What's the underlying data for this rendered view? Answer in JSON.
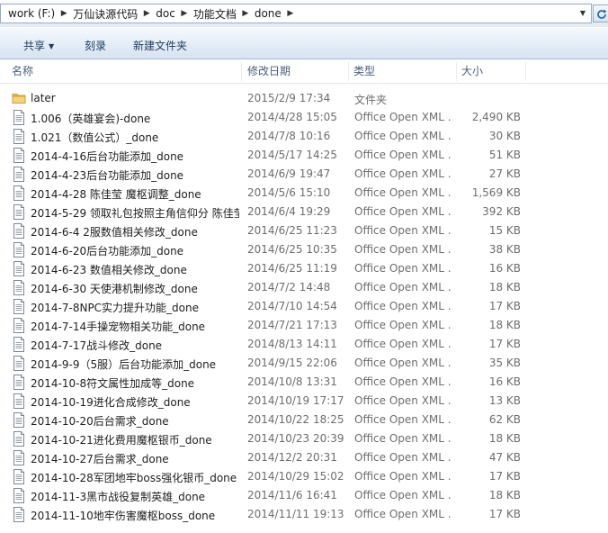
{
  "address": {
    "crumbs": [
      "work (F:)",
      "万仙诀源代码",
      "doc",
      "功能文档",
      "done"
    ]
  },
  "toolbar": {
    "share_label": "共享",
    "burn_label": "刻录",
    "new_folder_label": "新建文件夹"
  },
  "columns": {
    "name": "名称",
    "date": "修改日期",
    "type": "类型",
    "size": "大小"
  },
  "files": [
    {
      "kind": "folder",
      "name": "later",
      "date": "2015/2/9 17:34",
      "type": "文件夹",
      "size": ""
    },
    {
      "kind": "doc",
      "name": "1.006（英雄宴会)-done",
      "date": "2014/4/28 15:05",
      "type": "Office Open XML ...",
      "size": "2,490 KB"
    },
    {
      "kind": "doc",
      "name": "1.021（数值公式）_done",
      "date": "2014/7/8 10:16",
      "type": "Office Open XML ...",
      "size": "30 KB"
    },
    {
      "kind": "doc",
      "name": "2014-4-16后台功能添加_done",
      "date": "2014/5/17 14:25",
      "type": "Office Open XML ...",
      "size": "51 KB"
    },
    {
      "kind": "doc",
      "name": "2014-4-23后台功能添加_done",
      "date": "2014/6/9 19:47",
      "type": "Office Open XML ...",
      "size": "27 KB"
    },
    {
      "kind": "doc",
      "name": "2014-4-28 陈佳莹 魔枢调整_done",
      "date": "2014/5/6 15:10",
      "type": "Office Open XML ...",
      "size": "1,569 KB"
    },
    {
      "kind": "doc",
      "name": "2014-5-29 领取礼包按照主角信仰分 陈佳莹_done",
      "date": "2014/6/4 19:29",
      "type": "Office Open XML ...",
      "size": "392 KB"
    },
    {
      "kind": "doc",
      "name": "2014-6-4 2服数值相关修改_done",
      "date": "2014/6/25 11:23",
      "type": "Office Open XML ...",
      "size": "15 KB"
    },
    {
      "kind": "doc",
      "name": "2014-6-20后台功能添加_done",
      "date": "2014/6/25 10:35",
      "type": "Office Open XML ...",
      "size": "38 KB"
    },
    {
      "kind": "doc",
      "name": "2014-6-23 数值相关修改_done",
      "date": "2014/6/25 11:19",
      "type": "Office Open XML ...",
      "size": "16 KB"
    },
    {
      "kind": "doc",
      "name": "2014-6-30 天使港机制修改_done",
      "date": "2014/7/2 14:48",
      "type": "Office Open XML ...",
      "size": "18 KB"
    },
    {
      "kind": "doc",
      "name": "2014-7-8NPC实力提升功能_done",
      "date": "2014/7/10 14:54",
      "type": "Office Open XML ...",
      "size": "17 KB"
    },
    {
      "kind": "doc",
      "name": "2014-7-14手操宠物相关功能_done",
      "date": "2014/7/21 17:13",
      "type": "Office Open XML ...",
      "size": "18 KB"
    },
    {
      "kind": "doc",
      "name": "2014-7-17战斗修改_done",
      "date": "2014/8/13 14:11",
      "type": "Office Open XML ...",
      "size": "17 KB"
    },
    {
      "kind": "doc",
      "name": "2014-9-9（5服）后台功能添加_done",
      "date": "2014/9/15 22:06",
      "type": "Office Open XML ...",
      "size": "35 KB"
    },
    {
      "kind": "doc",
      "name": "2014-10-8符文属性加成等_done",
      "date": "2014/10/8 13:31",
      "type": "Office Open XML ...",
      "size": "16 KB"
    },
    {
      "kind": "doc",
      "name": "2014-10-19进化合成修改_done",
      "date": "2014/10/19 17:17",
      "type": "Office Open XML ...",
      "size": "13 KB"
    },
    {
      "kind": "doc",
      "name": "2014-10-20后台需求_done",
      "date": "2014/10/22 18:25",
      "type": "Office Open XML ...",
      "size": "62 KB"
    },
    {
      "kind": "doc",
      "name": "2014-10-21进化费用魔枢银币_done",
      "date": "2014/10/23 20:39",
      "type": "Office Open XML ...",
      "size": "18 KB"
    },
    {
      "kind": "doc",
      "name": "2014-10-27后台需求_done",
      "date": "2014/12/2 20:31",
      "type": "Office Open XML ...",
      "size": "47 KB"
    },
    {
      "kind": "doc",
      "name": "2014-10-28军团地牢boss强化银币_done",
      "date": "2014/10/29 15:02",
      "type": "Office Open XML ...",
      "size": "17 KB"
    },
    {
      "kind": "doc",
      "name": "2014-11-3黑市战役复制英雄_done",
      "date": "2014/11/6 16:41",
      "type": "Office Open XML ...",
      "size": "18 KB"
    },
    {
      "kind": "doc",
      "name": "2014-11-10地牢伤害魔枢boss_done",
      "date": "2014/11/11 19:13",
      "type": "Office Open XML ...",
      "size": "17 KB"
    }
  ]
}
